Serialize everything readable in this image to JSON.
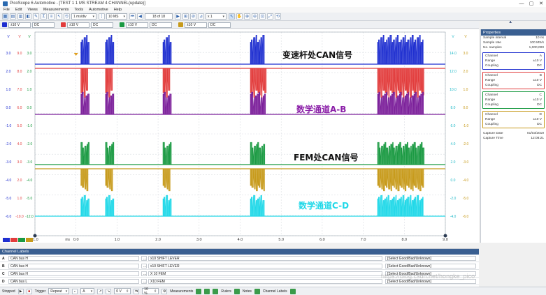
{
  "window": {
    "title": "PicoScope 6 Automotive - [TEST 1 1 MS STREAM 4 CHANNEL(update)]",
    "controls": [
      "—",
      "▢",
      "✕"
    ]
  },
  "menu": [
    "File",
    "Edit",
    "Views",
    "Measurements",
    "Tools",
    "Automotive",
    "Help"
  ],
  "toolbar": {
    "timebase": "1 ms/div",
    "samples": "10 MS",
    "buffer": "18 of 18",
    "zoom": "x 1"
  },
  "brand": {
    "logo": "pico"
  },
  "channels": [
    {
      "id": "A",
      "range": "±10 V",
      "coupling": "DC",
      "color": "#1f2fd0"
    },
    {
      "id": "B",
      "range": "±10 V",
      "coupling": "DC",
      "color": "#e23c3c"
    },
    {
      "id": "C",
      "range": "±10 V",
      "coupling": "DC",
      "color": "#1a9a42"
    },
    {
      "id": "D",
      "range": "±10 V",
      "coupling": "DC",
      "color": "#c79a1a"
    },
    {
      "id": "math1",
      "color": "#7b1f9a"
    },
    {
      "id": "math2",
      "color": "#20d8e8"
    }
  ],
  "scope": {
    "x_ticks": [
      "-1.0",
      "0.0",
      "1.0",
      "2.0",
      "3.0",
      "4.0",
      "5.0",
      "6.0",
      "7.0",
      "8.0",
      "9.0"
    ],
    "x_unit": "ms",
    "left_axes": {
      "col1": [
        "3.0",
        "2.0",
        "1.0",
        "0.0",
        "-1.0",
        "-2.0",
        "-3.0",
        "-4.0",
        "-5.0",
        "-6.0"
      ],
      "col2": [
        "9.0",
        "8.0",
        "7.0",
        "6.0",
        "5.0",
        "4.0",
        "3.0",
        "2.0",
        "1.0",
        "-10.0"
      ],
      "col3": [
        "3.0",
        "2.0",
        "1.0",
        "0.0",
        "-1.0",
        "-2.0",
        "-3.0",
        "-4.0",
        "-5.0",
        "-12.0"
      ]
    },
    "right_axes": {
      "col1": [
        "14.0",
        "12.0",
        "10.0",
        "8.0",
        "6.0",
        "4.0",
        "2.0",
        "0.0",
        "-2.0",
        "-4.0"
      ],
      "col2": [
        "3.0",
        "2.0",
        "1.0",
        "0.0",
        "-1.0",
        "-2.0",
        "-3.0",
        "-4.0",
        "-5.0",
        "-6.0"
      ]
    },
    "units_row": "V",
    "annotations": [
      {
        "text": "变速杆处CAN信号",
        "color": "#111111"
      },
      {
        "text": "数学通道A-B",
        "color": "#8b1fa8"
      },
      {
        "text": "FEM处CAN信号",
        "color": "#111111"
      },
      {
        "text": "数学通道C-D",
        "color": "#20d8e8"
      }
    ]
  },
  "properties": {
    "title": "Properties",
    "general": [
      {
        "k": "Sample interval",
        "v": "10 ns"
      },
      {
        "k": "Sample rate",
        "v": "100 MS/s"
      },
      {
        "k": "No. samples",
        "v": "1,000,000"
      }
    ],
    "channels": [
      {
        "ch": "A",
        "range": "±10 V",
        "coupling": "DC"
      },
      {
        "ch": "B",
        "range": "±10 V",
        "coupling": "DC"
      },
      {
        "ch": "C",
        "range": "±10 V",
        "coupling": "DC"
      },
      {
        "ch": "D",
        "range": "±10 V",
        "coupling": "DC"
      }
    ],
    "labels": {
      "channel": "Channel",
      "range": "Range",
      "coupling": "Coupling"
    },
    "capture": [
      {
        "k": "Capture Date",
        "v": "01/03/2019"
      },
      {
        "k": "Capture Time",
        "v": "12:08:21"
      }
    ]
  },
  "channel_labels": {
    "title": "Channel Labels",
    "rows": [
      {
        "ch": "A",
        "name": "CAN bus H",
        "desc": "x10 SHIFT LEVER",
        "status": "[Select Good/Bad/Unknown]"
      },
      {
        "ch": "B",
        "name": "CAN bus H",
        "desc": "x10 SHIFT LEVER",
        "status": "[Select Good/Bad/Unknown]"
      },
      {
        "ch": "C",
        "name": "CAN bus H",
        "desc": "X 10 FEM",
        "status": "[Select Good/Bad/Unknown]"
      },
      {
        "ch": "D",
        "name": "CAN bus L",
        "desc": "X10 FEM",
        "status": "[Select Good/Bad/Unknown]"
      }
    ]
  },
  "status": {
    "run": "Stopped",
    "trigger_label": "Trigger",
    "trigger_mode": "Repeat",
    "trigger_channel": "A",
    "trigger_level": "0 V",
    "pretrigger": "10 %",
    "measurements": "Measurements",
    "rulers": "Rulers",
    "notes": "Notes",
    "channel_labels": "Channel Labels"
  },
  "watermark": "https://blog.csdn.net/hongke_pico"
}
